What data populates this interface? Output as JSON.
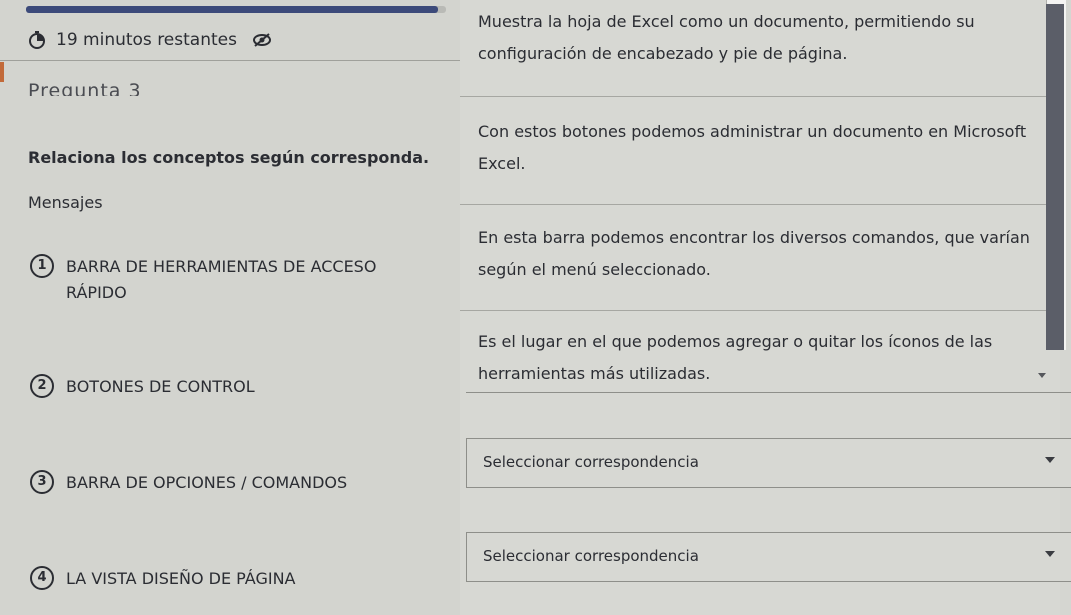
{
  "quiz": {
    "timer_text": "19 minutos restantes",
    "progress": 0.98,
    "question_title": "Pregunta 3",
    "instruction": "Relaciona los conceptos según corresponda.",
    "messages_label": "Mensajes"
  },
  "items": [
    {
      "number": "1",
      "label": "BARRA DE HERRAMIENTAS DE ACCESO RÁPIDO"
    },
    {
      "number": "2",
      "label": "BOTONES DE CONTROL"
    },
    {
      "number": "3",
      "label": "BARRA DE OPCIONES / COMANDOS"
    },
    {
      "number": "4",
      "label": "LA VISTA DISEÑO DE PÁGINA"
    }
  ],
  "definitions": [
    "Muestra la hoja de Excel como un documento, permitiendo su configuración de encabezado y pie de página.",
    "Con estos botones podemos administrar un documento en Microsoft Excel.",
    "En esta barra podemos encontrar los diversos comandos, que varían según el menú seleccionado.",
    "Es el lugar en el que podemos agregar o quitar los íconos de las herramientas más utilizadas."
  ],
  "selects": [
    {
      "placeholder": "Seleccionar correspondencia"
    },
    {
      "placeholder": "Seleccionar correspondencia"
    }
  ],
  "colors": {
    "accent": "#3c4a7a",
    "text": "#2b2d33"
  }
}
